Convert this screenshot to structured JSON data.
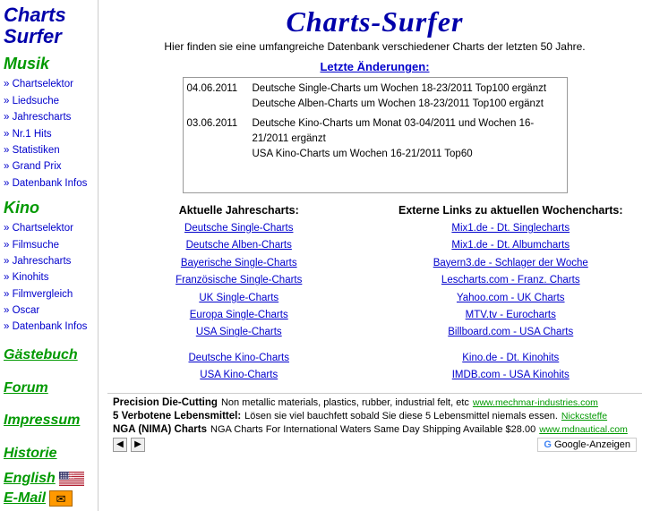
{
  "sidebar": {
    "logo_line1": "Charts",
    "logo_line2": "Surfer",
    "musik_title": "Musik",
    "musik_links": [
      {
        "label": "Chartselektor",
        "href": "#"
      },
      {
        "label": "Liedsuche",
        "href": "#"
      },
      {
        "label": "Jahrescharts",
        "href": "#"
      },
      {
        "label": "Nr.1 Hits",
        "href": "#"
      },
      {
        "label": "Statistiken",
        "href": "#"
      },
      {
        "label": "Grand Prix",
        "href": "#"
      },
      {
        "label": "Datenbank Infos",
        "href": "#"
      }
    ],
    "kino_title": "Kino",
    "kino_links": [
      {
        "label": "Chartselektor",
        "href": "#"
      },
      {
        "label": "Filmsuche",
        "href": "#"
      },
      {
        "label": "Jahrescharts",
        "href": "#"
      },
      {
        "label": "Kinohits",
        "href": "#"
      },
      {
        "label": "Filmvergleich",
        "href": "#"
      },
      {
        "label": "Oscar",
        "href": "#"
      },
      {
        "label": "Datenbank Infos",
        "href": "#"
      }
    ],
    "standalone": [
      "Gästebuch",
      "Forum",
      "Impressum",
      "Historie"
    ],
    "lang_label": "English",
    "email_label": "E-Mail"
  },
  "main": {
    "title": "Charts-Surfer",
    "subtitle": "Hier finden sie eine umfangreiche Datenbank verschiedener Charts der letzten 50 Jahre.",
    "letzte_title": "Letzte Änderungen:",
    "updates": [
      {
        "date": "04.06.2011",
        "text": "Deutsche Single-Charts um Wochen 18-23/2011 Top100 ergänzt\nDeutsche Alben-Charts um Wochen 18-23/2011 Top100 ergänzt"
      },
      {
        "date": "03.06.2011",
        "text": "Deutsche Kino-Charts um Monat 03-04/2011 und Wochen 16-21/2011 ergänzt\nUSA Kino-Charts um Wochen 16-21/2011 Top60"
      }
    ],
    "aktuelle_title": "Aktuelle Jahrescharts:",
    "aktuelle_links": [
      {
        "label": "Deutsche Single-Charts",
        "href": "#"
      },
      {
        "label": "Deutsche Alben-Charts",
        "href": "#"
      },
      {
        "label": "Bayerische Single-Charts",
        "href": "#"
      },
      {
        "label": "Französische Single-Charts",
        "href": "#"
      },
      {
        "label": "UK Single-Charts",
        "href": "#"
      },
      {
        "label": "Europa Single-Charts",
        "href": "#"
      },
      {
        "label": "USA Single-Charts",
        "href": "#"
      }
    ],
    "kino_aktuelle_links": [
      {
        "label": "Deutsche Kino-Charts",
        "href": "#"
      },
      {
        "label": "USA Kino-Charts",
        "href": "#"
      }
    ],
    "externe_title": "Externe Links zu aktuellen Wochencharts:",
    "externe_links": [
      {
        "label": "Mix1.de - Dt. Singlecharts",
        "href": "#"
      },
      {
        "label": "Mix1.de - Dt. Albumcharts",
        "href": "#"
      },
      {
        "label": "Bayern3.de - Schlager der Woche",
        "href": "#"
      },
      {
        "label": "Lescharts.com - Franz. Charts",
        "href": "#"
      },
      {
        "label": "Yahoo.com - UK Charts",
        "href": "#"
      },
      {
        "label": "MTV.tv - Eurocharts",
        "href": "#"
      },
      {
        "label": "Billboard.com - USA Charts",
        "href": "#"
      }
    ],
    "externe_kino_links": [
      {
        "label": "Kino.de - Dt. Kinohits",
        "href": "#"
      },
      {
        "label": "IMDB.com - USA Kinohits",
        "href": "#"
      }
    ]
  },
  "ads": [
    {
      "bold": "Precision Die-Cutting",
      "text": "Non metallic materials, plastics, rubber, industrial felt, etc",
      "link_text": "www.mechmar-industries.com",
      "link_href": "#"
    },
    {
      "bold": "5 Verbotene Lebensmittel:",
      "text": "Lösen sie viel bauchfett sobald Sie diese 5 Lebensmittel niemals essen.",
      "link_text": "Nickcsteffe",
      "link_href": "#"
    },
    {
      "bold": "NGA (NIMA) Charts",
      "text": "NGA Charts For International Waters Same Day Shipping Available $28.00",
      "link_text": "www.mdnautical.com",
      "link_href": "#"
    }
  ],
  "google_label": "Google-Anzeigen"
}
